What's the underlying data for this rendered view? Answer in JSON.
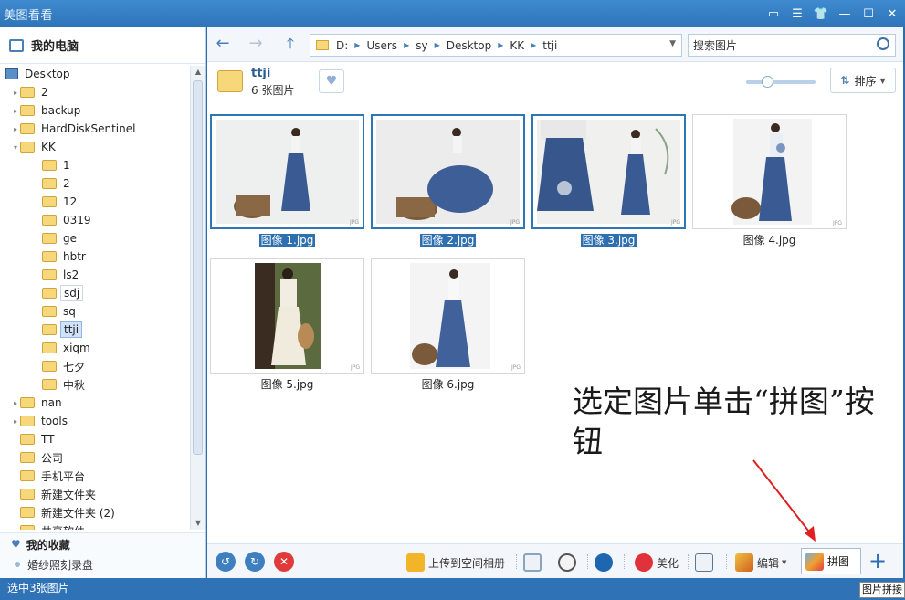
{
  "title": "美图看看",
  "left": {
    "header": "我的电脑",
    "tree": [
      {
        "label": "Desktop",
        "level": 0,
        "type": "desktop"
      },
      {
        "label": "2",
        "level": 1,
        "arrow": "▸"
      },
      {
        "label": "backup",
        "level": 1,
        "arrow": "▸"
      },
      {
        "label": "HardDiskSentinel",
        "level": 1,
        "arrow": "▸"
      },
      {
        "label": "KK",
        "level": 1,
        "arrow": "▾"
      },
      {
        "label": "1",
        "level": 2
      },
      {
        "label": "2",
        "level": 2
      },
      {
        "label": "12",
        "level": 2
      },
      {
        "label": "0319",
        "level": 2
      },
      {
        "label": "ge",
        "level": 2
      },
      {
        "label": "hbtr",
        "level": 2
      },
      {
        "label": "ls2",
        "level": 2
      },
      {
        "label": "sdj",
        "level": 2,
        "state": "hover"
      },
      {
        "label": "sq",
        "level": 2
      },
      {
        "label": "ttji",
        "level": 2,
        "state": "sel"
      },
      {
        "label": "xiqm",
        "level": 2
      },
      {
        "label": "七夕",
        "level": 2
      },
      {
        "label": "中秋",
        "level": 2
      },
      {
        "label": "nan",
        "level": 1,
        "arrow": "▸"
      },
      {
        "label": "tools",
        "level": 1,
        "arrow": "▸"
      },
      {
        "label": "TT",
        "level": 1
      },
      {
        "label": "公司",
        "level": 1
      },
      {
        "label": "手机平台",
        "level": 1
      },
      {
        "label": "新建文件夹",
        "level": 1
      },
      {
        "label": "新建文件夹 (2)",
        "level": 1
      },
      {
        "label": "共享软件",
        "level": 1
      }
    ],
    "favorites_header": "我的收藏",
    "favorites": [
      "婚纱照刻录盘"
    ]
  },
  "toolbar": {
    "path": [
      "D:",
      "Users",
      "sy",
      "Desktop",
      "KK",
      "ttji"
    ],
    "search_placeholder": "搜索图片"
  },
  "folder": {
    "name": "ttji",
    "count": "6 张图片"
  },
  "sort_label": "排序",
  "zoom_level": 0.3,
  "images": [
    {
      "name": "图像 1.jpg",
      "selected": true
    },
    {
      "name": "图像 2.jpg",
      "selected": true
    },
    {
      "name": "图像 3.jpg",
      "selected": true
    },
    {
      "name": "图像 4.jpg",
      "selected": false
    },
    {
      "name": "图像 5.jpg",
      "selected": false
    },
    {
      "name": "图像 6.jpg",
      "selected": false
    }
  ],
  "jpg_tag": "JPG",
  "annotation": "选定图片单击“拼图”按钮",
  "bottom": {
    "upload": "上传到空间相册",
    "beautify": "美化",
    "edit": "编辑",
    "collage": "拼图",
    "tooltip": "图片拼接"
  },
  "status": "选中3张图片",
  "colors": {
    "accent": "#2f72b6",
    "annotation_arrow": "#e02020"
  }
}
